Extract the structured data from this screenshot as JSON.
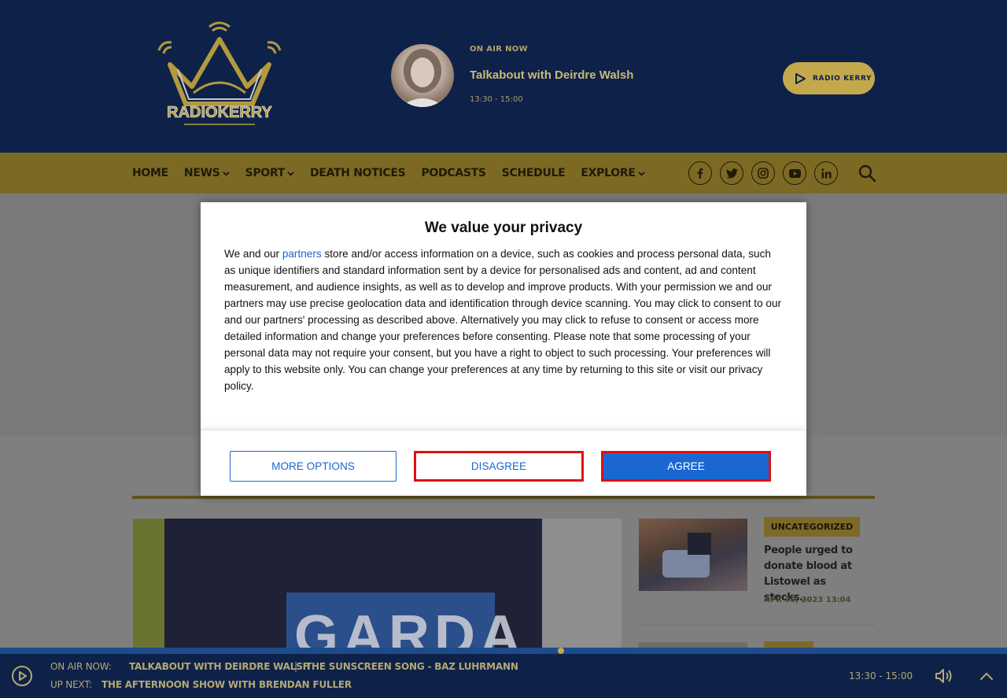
{
  "header": {
    "logo_text": "RADIOKERRY",
    "onair_label": "ON AIR NOW",
    "show_title": "Talkabout with Deirdre Walsh",
    "show_time": "13:30 - 15:00",
    "play_button_label": "RADIO KERRY"
  },
  "nav": {
    "items": [
      {
        "label": "HOME",
        "has_dropdown": false
      },
      {
        "label": "NEWS",
        "has_dropdown": true
      },
      {
        "label": "SPORT",
        "has_dropdown": true
      },
      {
        "label": "DEATH NOTICES",
        "has_dropdown": false
      },
      {
        "label": "PODCASTS",
        "has_dropdown": false
      },
      {
        "label": "SCHEDULE",
        "has_dropdown": false
      },
      {
        "label": "EXPLORE",
        "has_dropdown": true
      }
    ],
    "social": [
      "facebook-icon",
      "twitter-icon",
      "instagram-icon",
      "youtube-icon",
      "linkedin-icon"
    ]
  },
  "modal": {
    "title": "We value your privacy",
    "text_before_link": "We and our ",
    "link_text": "partners",
    "text_after_link": " store and/or access information on a device, such as cookies and process personal data, such as unique identifiers and standard information sent by a device for personalised ads and content, ad and content measurement, and audience insights, as well as to develop and improve products. With your permission we and our partners may use precise geolocation data and identification through device scanning. You may click to consent to our and our partners' processing as described above. Alternatively you may click to refuse to consent or access more detailed information and change your preferences before consenting. Please note that some processing of your personal data may not require your consent, but you have a right to object to such processing. Your preferences will apply to this website only. You can change your preferences at any time by returning to this site or visit our privacy policy.",
    "more_options_label": "MORE OPTIONS",
    "disagree_label": "DISAGREE",
    "agree_label": "AGREE"
  },
  "hero": {
    "badge_text": "GARDA"
  },
  "sidebar_article": {
    "category": "UNCATEGORIZED",
    "title": "People urged to donate blood at Listowel as stocks…",
    "date": "APR 30, 2023 13:04"
  },
  "player": {
    "onair_label": "ON AIR NOW:",
    "current_show": "TALKABOUT WITH DEIRDRE WALSH",
    "separator": "|",
    "current_song": "THE SUNSCREEN SONG - BAZ LUHRMANN",
    "upnext_label": "UP NEXT:",
    "next_show": "THE AFTERNOON SHOW WITH BRENDAN FULLER",
    "time": "13:30 - 15:00",
    "progress": 0.557
  },
  "colors": {
    "brand_navy": "#0e2149",
    "brand_gold": "#c4a94c",
    "link_blue": "#1a67d2",
    "highlight_red": "#e01010"
  }
}
